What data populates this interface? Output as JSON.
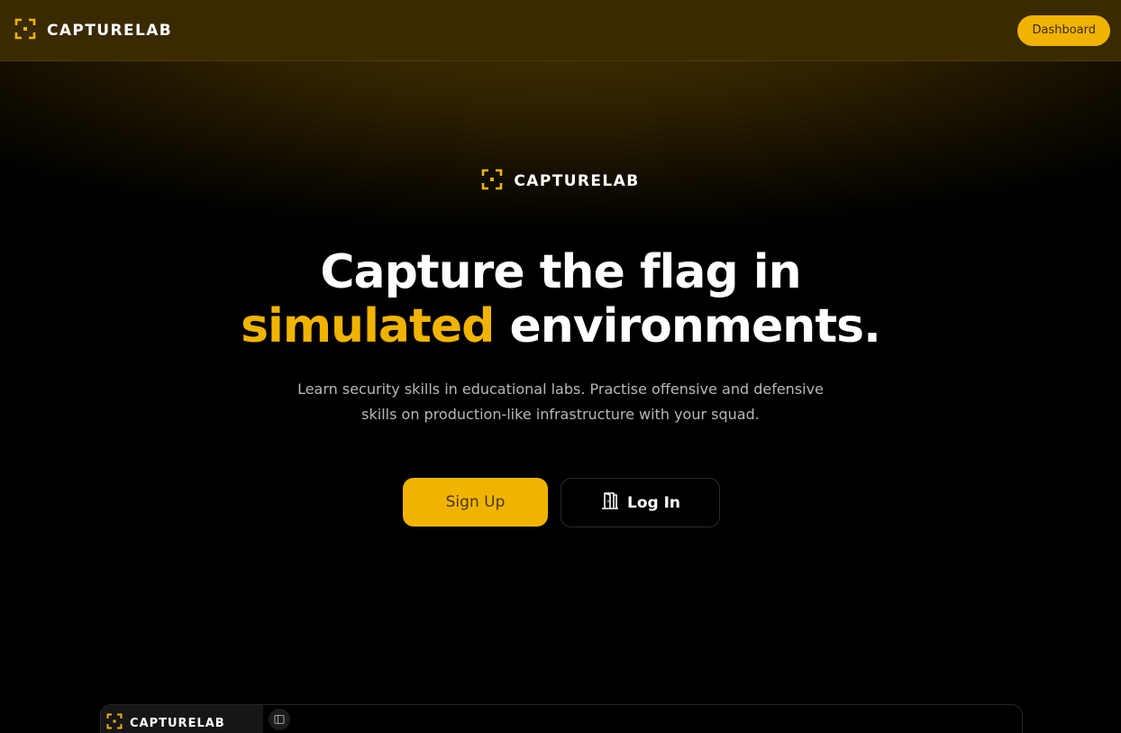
{
  "colors": {
    "accent": "#f0b400",
    "navbar_bg": "#3a2a00",
    "background": "#000000"
  },
  "navbar": {
    "brand": "CAPTURELAB",
    "logo_icon": "capture-frame-icon",
    "dashboard_label": "Dashboard"
  },
  "hero": {
    "brand": "CAPTURELAB",
    "title_line1": "Capture the flag in",
    "title_accent": "simulated",
    "title_rest": " environments.",
    "subtitle": "Learn security skills in educational labs. Practise offensive and defensive skills on production-like infrastructure with your squad.",
    "signup_label": "Sign Up",
    "login_label": "Log In",
    "login_icon": "door-icon"
  },
  "preview": {
    "brand": "CAPTURELAB",
    "toggle_icon": "sidebar-toggle-icon"
  }
}
